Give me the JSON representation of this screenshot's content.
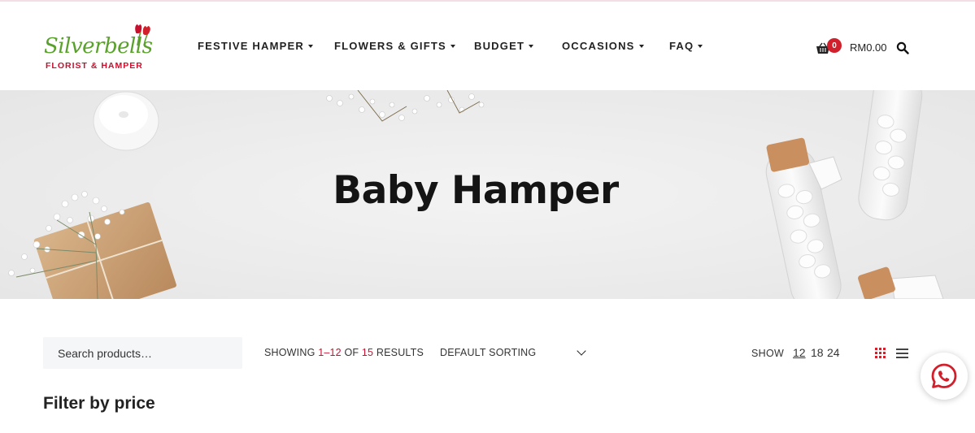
{
  "brand": {
    "name": "Silverbells",
    "tagline": "FLORIST & HAMPER",
    "colors": {
      "green": "#5aa02c",
      "red": "#c8102e"
    }
  },
  "nav": {
    "items": [
      {
        "label": "FESTIVE HAMPER",
        "icon": "caret-down-icon"
      },
      {
        "label": "FLOWERS & GIFTS",
        "icon": "caret-down-icon"
      },
      {
        "label": "BUDGET",
        "icon": "caret-down-icon"
      },
      {
        "label": "OCCASIONS",
        "icon": "caret-down-icon"
      },
      {
        "label": "FAQ",
        "icon": "caret-down-icon"
      }
    ]
  },
  "cart": {
    "count": "0",
    "total": "RM0.00",
    "icon": "basket-icon",
    "badge_color": "#d11f2b"
  },
  "header_search": {
    "icon": "search-icon"
  },
  "hero": {
    "title": "Baby Hamper"
  },
  "toolbar": {
    "search_placeholder": "Search products…",
    "showing": {
      "prefix": "SHOWING ",
      "range": "1–12",
      "mid": " OF ",
      "total": "15",
      "suffix": " RESULTS"
    },
    "sorting": "DEFAULT SORTING",
    "show_label": "SHOW",
    "per_page": [
      "12",
      "18",
      "24"
    ],
    "per_page_selected": "12",
    "views": {
      "grid": "grid-view-icon",
      "list": "list-view-icon",
      "active": "grid"
    }
  },
  "sidebar": {
    "filter_heading": "Filter by price"
  },
  "whatsapp": {
    "icon": "whatsapp-icon",
    "color": "#d11f2b"
  }
}
